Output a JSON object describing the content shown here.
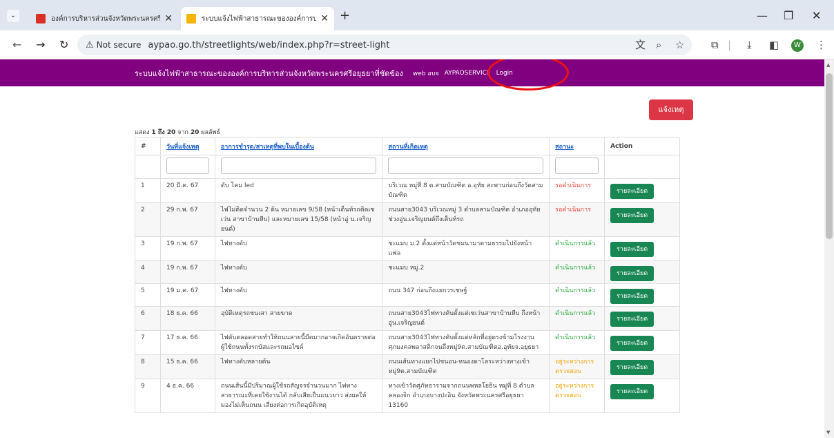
{
  "browser": {
    "tabs": [
      {
        "title": "องค์การบริหารส่วนจังหวัดพระนครศรี",
        "favicon_color": "#d93025"
      },
      {
        "title": "ระบบแจ้งไฟฟ้าสาธารณะขององค์การบ",
        "favicon_color": "#f4b400"
      }
    ],
    "new_tab": "+",
    "security_label": "Not secure",
    "url": "aypao.go.th/streetlights/web/index.php?r=street-light",
    "profile_initial": "W",
    "accent": "#dfe6ef"
  },
  "site": {
    "nav_bg": "#800080",
    "brand": "ระบบแจ้งไฟฟ้าสาธารณะขององค์การบริหารส่วนจังหวัดพระนครศรีอยุธยาที่ชัดข้อง",
    "links": [
      "web อบจ",
      "AYPAOSERVICE",
      "Login"
    ],
    "report_button": "แจ้งเหตุ",
    "summary_prefix": "แสดง ",
    "summary_range": "1 ถึง 20",
    "summary_mid": " จาก ",
    "summary_total": "20",
    "summary_suffix": " ผลลัพธ์"
  },
  "table": {
    "columns": [
      "#",
      "วันที่แจ้งเหตุ",
      "อาการชำรุด/สาเหตุที่พบในเบื้องต้น",
      "สถานที่เกิดเหตุ",
      "สถานะ",
      "Action"
    ],
    "detail_label": "รายละเอียด",
    "rows": [
      {
        "no": "1",
        "date": "20 มี.ค. 67",
        "issue": "ดับ โคม led",
        "place": "บริเวณ หมู่ที่ 8 ต.สามบัณฑิต อ.อุทัย สะพานก่อนถึงวัดสามบัณฑิต",
        "status": "รอดำเนินการ",
        "status_type": "wait"
      },
      {
        "no": "2",
        "date": "29 ก.พ. 67",
        "issue": "ไฟไม่ติดจำนวน 2 ต้น หมายเลข 9/58 (หน้าเต็นท์รถติดเซเว่น สาขาบ้านหีบ) และหมายเลข 15/58 (หน้าอู่ น.เจริญยนต์)",
        "place": "ถนนสาย3043 บริเวณหมู่ 3 ตำบลสามบัณฑิต อำเภออุทัย ช่วงอู่น.เจริญยนต์ถึงเต็นท์รถ",
        "status": "รอดำเนินการ",
        "status_type": "wait"
      },
      {
        "no": "3",
        "date": "19 ก.พ. 67",
        "issue": "ไฟทางดับ",
        "place": "ชะแมบ ม.2 ตั้งแต่หน้าวัดชมนามาตามธรรมไปยังหน้าแฟล",
        "status": "ดำเนินการแล้ว",
        "status_type": "done"
      },
      {
        "no": "4",
        "date": "19 ก.พ. 67",
        "issue": "ไฟทางดับ",
        "place": "ชะแมบ หมู่.2",
        "status": "ดำเนินการแล้ว",
        "status_type": "done"
      },
      {
        "no": "5",
        "date": "19 ม.ค. 67",
        "issue": "ไฟทางดับ",
        "place": "ถนน 347 ก่อนถึงแยกวรเชษฐ์",
        "status": "ดำเนินการแล้ว",
        "status_type": "done"
      },
      {
        "no": "6",
        "date": "18 ธ.ค. 66",
        "issue": "อุบัติเหตุรถชนเสา สายขาด",
        "place": "ถนนสาย3043ไฟทางดับตั้งแต่เซเว่นสาขาบ้านหีบ ถึงหน้าอู่น.เจริญยนต์",
        "status": "ดำเนินการแล้ว",
        "status_type": "done"
      },
      {
        "no": "7",
        "date": "17 ธ.ค. 66",
        "issue": "ไฟดับตลอดสายทำให้ถนนสายนี้มืดมากอาจเกิดอันตรายต่อผู้ใช้ถนนทั้งรถบัสและรถมอไซค์",
        "place": "ถนนสาย3043ไฟทางดับตั้งแต่หลักที่อยู่ตรงข้ามโรงงานศุภมงคลพลาสติกจนถึงหมู่9ต.สามบัณฑิตอ.อุทัยจ.อยุธยา",
        "status": "ดำเนินการแล้ว",
        "status_type": "done"
      },
      {
        "no": "8",
        "date": "15 ธ.ค. 66",
        "issue": "ไฟทางดับหลายต้น",
        "place": "ถนนเส้นทางแยกไปชนอน-หนองดาโลระหว่างทางเข้าหมู่9ต.สามบัณฑิต",
        "status": "อยู่ระหว่างการตรวจสอบ",
        "status_type": "check"
      },
      {
        "no": "9",
        "date": "4 ธ.ค. 66",
        "issue": "ถนนเส้นนี้มีปริมาณผู้ใช้รถสัญจรจำนวนมาก ไฟทางสาธารณะที่เคยใช้งานได้ กลับเสียเป็นแนวยาว ส่งผลให้มองไม่เห็นถนน เสี่ยงต่อการเกิดอุบัติเหตุ",
        "place": "ทางเข้าวัดศุภัทธารามจากถนนพหลโยธิน หมู่ที่ 8 ตำบลคลองจิก อำเภอบางปะอิน จังหวัดพระนครศรีอยุธยา 13160",
        "status": "อยู่ระหว่างการตรวจสอบ",
        "status_type": "check"
      }
    ]
  }
}
